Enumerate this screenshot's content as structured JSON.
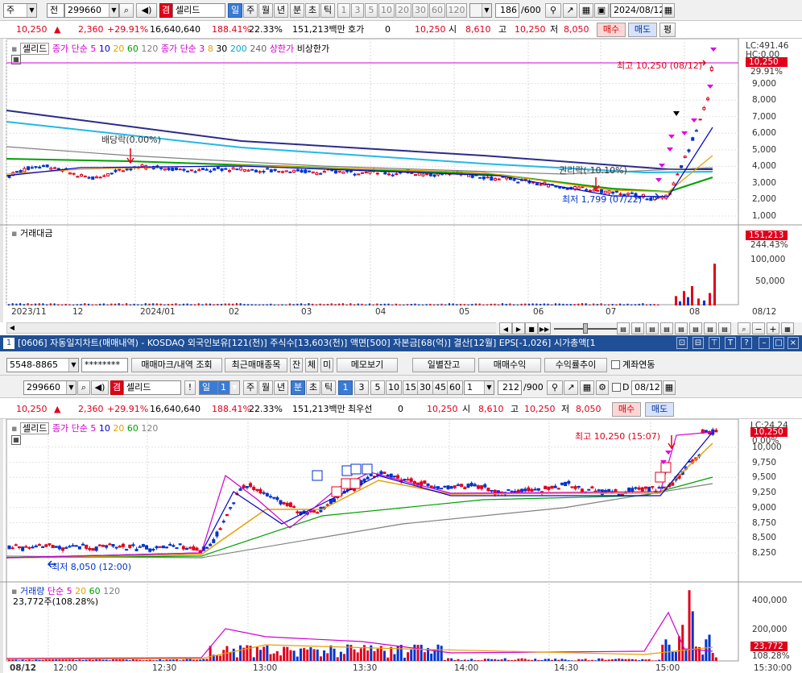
{
  "top": {
    "market": "주",
    "chart_mode": "전",
    "code": "299660",
    "badge": "겸",
    "name": "셀리드",
    "periods": [
      "일",
      "주",
      "월",
      "년",
      "분",
      "초",
      "틱"
    ],
    "nums": [
      "1",
      "3",
      "5",
      "10",
      "20",
      "30",
      "60",
      "120"
    ],
    "count": "186",
    "count_total": "/600",
    "date": "2024/08/12"
  },
  "quote1": {
    "price": "10,250",
    "arrow": "▲",
    "change": "2,360",
    "pct": "+29.91%",
    "volume": "16,640,640",
    "vol_pct": "188.41%",
    "turnover": "22.33%",
    "amount": "151,213백만",
    "hoga_label": "호가",
    "hoga_val": "0",
    "last": "10,250",
    "open_label": "시",
    "open": "8,610",
    "high_label": "고",
    "high": "10,250",
    "low_label": "저",
    "low": "8,050",
    "buy": "매수",
    "sell": "매도",
    "eval": "평"
  },
  "daily": {
    "legend_name": "셀리드",
    "legend_ma": "종가 단순 5",
    "legend_ma_vals": [
      "10",
      "20",
      "60",
      "120"
    ],
    "legend_ma2": "종가 단순 3",
    "legend_ma2_vals": [
      "8",
      "30",
      "200",
      "240"
    ],
    "legend_upper": "상한가",
    "legend_vi": "비상한가",
    "lc": "LC:491.46",
    "hc": "HC:0.00",
    "price_tag": "10,250",
    "pct_tag": "29.91%",
    "y_ticks": [
      "9,000",
      "8,000",
      "7,000",
      "6,000",
      "5,000",
      "4,000",
      "3,000",
      "2,000",
      "1,000"
    ],
    "ann_high": "최고 10,250 (08/12)",
    "ann_div": "배당락(0.00%)",
    "ann_rights": "권리락(-10.10%)",
    "ann_low": "최저 1,799 (07/22)",
    "vol_title": "거래대금",
    "vol_tag": "151,213",
    "vol_pct_tag": "244.43%",
    "vol_ticks": [
      "100,000",
      "50,000"
    ],
    "x_labels": [
      "2023/11",
      "12",
      "2024/01",
      "02",
      "03",
      "04",
      "05",
      "06",
      "07",
      "08"
    ],
    "x_end": "08/12"
  },
  "window2": {
    "num": "1",
    "title": "[0606] 자동일지차트(매매내역) - KOSDAQ 외국인보유[121(천)] 주식수[13,603(천)] 액면[500] 자본금[68(억)] 결산[12월] EPS[-1,026] 시가총액[1"
  },
  "acct": {
    "account": "5548-8865",
    "password": "********",
    "btn_mark": "매매마크/내역 조회",
    "btn_recent": "최근매매종목",
    "btn_jan": "잔",
    "btn_che": "체",
    "btn_mi": "미",
    "btn_memo": "메모보기",
    "btn_daily": "일별잔고",
    "btn_profit": "매매수익",
    "btn_rate": "수익률추이",
    "chk_acct": "계좌연동"
  },
  "bot_toolbar": {
    "code": "299660",
    "badge": "겸",
    "name": "셀리드",
    "period": "일",
    "period_n": "1",
    "periods": [
      "주",
      "월",
      "년",
      "분",
      "초",
      "틱"
    ],
    "nums": [
      "1",
      "3",
      "5",
      "10",
      "15",
      "30",
      "45",
      "60"
    ],
    "interval": "1",
    "count": "212",
    "count_total": "/900",
    "d_label": "D",
    "date": "08/12"
  },
  "quote2": {
    "price": "10,250",
    "arrow": "▲",
    "change": "2,360",
    "pct": "+29.91%",
    "volume": "16,640,640",
    "vol_pct": "188.41%",
    "turnover": "22.33%",
    "amount": "151,213백만",
    "hoga_label": "최우선",
    "hoga_val": "0",
    "last": "10,250",
    "open_label": "시",
    "open": "8,610",
    "high_label": "고",
    "high": "10,250",
    "low_label": "저",
    "low": "8,050",
    "buy": "매수",
    "sell": "매도"
  },
  "intraday": {
    "legend_name": "셀리드",
    "legend_ma": "종가 단순 5",
    "legend_ma_vals": [
      "10",
      "20",
      "60",
      "120"
    ],
    "lc": "LC:24.24",
    "price_tag": "10,250",
    "pct_tag": "0.00%",
    "y_ticks": [
      "10,000",
      "9,750",
      "9,500",
      "9,250",
      "9,000",
      "8,750",
      "8,500",
      "8,250"
    ],
    "ann_high": "최고 10,250 (15:07)",
    "ann_low": "최저 8,050 (12:00)",
    "vol_title": "거래량",
    "vol_ma": "단순 5",
    "vol_ma_vals": [
      "20",
      "60",
      "120"
    ],
    "vol_now": "23,772주(108.28%)",
    "vol_tag": "23,772",
    "vol_pct_tag": "108.28%",
    "vol_ticks": [
      "400,000",
      "200,000"
    ],
    "x_labels": [
      "12:00",
      "12:30",
      "13:00",
      "13:30",
      "14:00",
      "14:30",
      "15:00"
    ],
    "x_start": "08/12",
    "x_end": "15:30:00"
  },
  "colors": {
    "up": "#e0001c",
    "down": "#0033cc",
    "ma5": "#d000d0",
    "ma10": "#0000cc",
    "ma20": "#e8a000",
    "ma60": "#00a000",
    "ma120": "#808080",
    "title_bar": "#1f4f96"
  }
}
